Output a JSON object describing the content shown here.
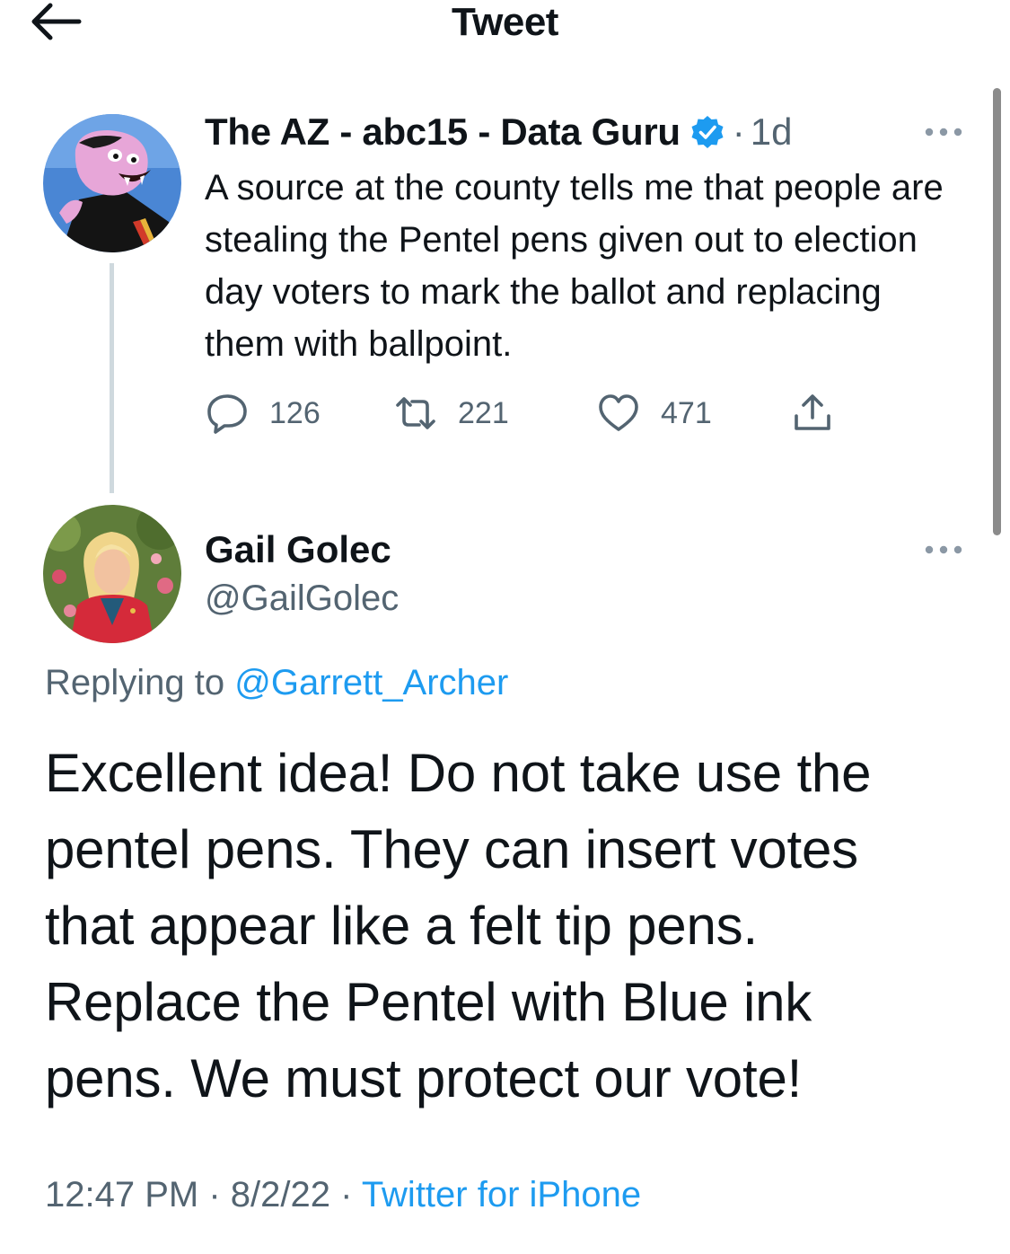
{
  "header": {
    "title": "Tweet"
  },
  "tweet": {
    "author_name": "The AZ - abc15 - Data Guru",
    "separator": "·",
    "time": "1d",
    "text": "A source at the county tells me that people are stealing the Pentel pens given out to election day voters to mark the ballot and replacing them with ballpoint.",
    "replies": "126",
    "retweets": "221",
    "likes": "471"
  },
  "reply": {
    "author_name": "Gail Golec",
    "handle": "@GailGolec",
    "replying_prefix": "Replying to ",
    "replying_to": "@Garrett_Archer",
    "text": "Excellent idea!   Do not take use the\npentel pens.  They can insert votes\nthat appear like a felt tip pens.\nReplace the Pentel with Blue ink\npens.   We must protect our vote!",
    "time": "12:47 PM",
    "dot1": " · ",
    "date": "8/2/22",
    "dot2": " · ",
    "source": "Twitter for iPhone"
  },
  "colors": {
    "accent": "#1d9bf0",
    "secondary_text": "#536471",
    "primary_text": "#0f1419"
  },
  "icons": [
    "back-arrow-icon",
    "verified-badge-icon",
    "more-icon",
    "reply-icon",
    "retweet-icon",
    "like-icon",
    "share-icon"
  ]
}
